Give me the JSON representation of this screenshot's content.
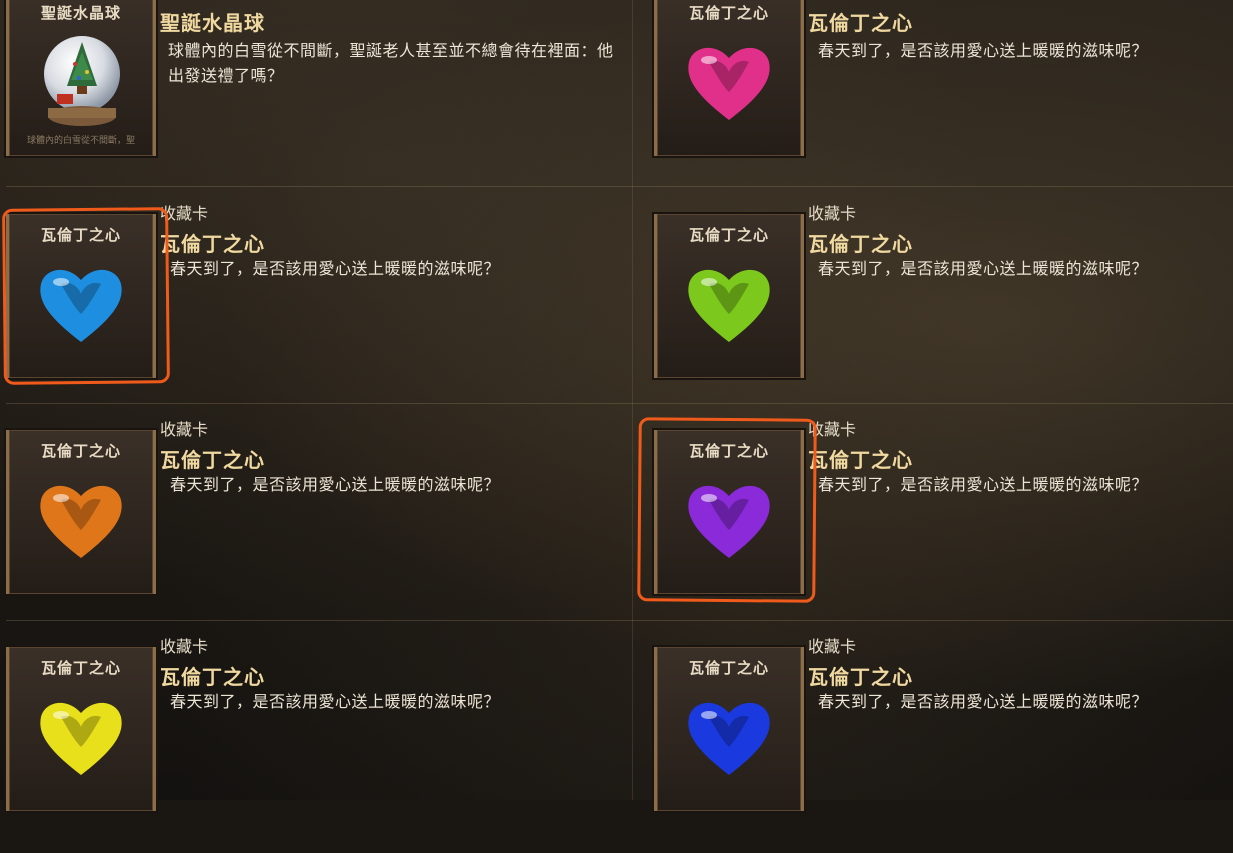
{
  "cards": [
    {
      "label": "",
      "title": "聖誕水晶球",
      "desc": "球體內的白雪從不間斷，聖誕老人甚至並不總會待在裡面：他出發送禮了嗎？",
      "thumb_title": "聖誕水晶球",
      "thumb_sub": "球體內的白雪從不間斷，聖",
      "icon": "snow-globe-icon"
    },
    {
      "label": "",
      "title": "瓦倫丁之心",
      "desc": "春天到了，是否該用愛心送上暖暖的滋味呢？",
      "thumb_title": "瓦倫丁之心",
      "color": "#e0308a",
      "icon": "pink-heart-icon"
    },
    {
      "label": "收藏卡",
      "title": "瓦倫丁之心",
      "desc": "春天到了，是否該用愛心送上暖暖的滋味呢？",
      "thumb_title": "瓦倫丁之心",
      "color": "#1e8fe0",
      "icon": "blue-heart-icon"
    },
    {
      "label": "收藏卡",
      "title": "瓦倫丁之心",
      "desc": "春天到了，是否該用愛心送上暖暖的滋味呢？",
      "thumb_title": "瓦倫丁之心",
      "color": "#7cc81c",
      "icon": "green-heart-icon"
    },
    {
      "label": "收藏卡",
      "title": "瓦倫丁之心",
      "desc": "春天到了，是否該用愛心送上暖暖的滋味呢？",
      "thumb_title": "瓦倫丁之心",
      "color": "#e0761a",
      "icon": "orange-heart-icon"
    },
    {
      "label": "收藏卡",
      "title": "瓦倫丁之心",
      "desc": "春天到了，是否該用愛心送上暖暖的滋味呢？",
      "thumb_title": "瓦倫丁之心",
      "color": "#8a2ad8",
      "icon": "purple-heart-icon"
    },
    {
      "label": "收藏卡",
      "title": "瓦倫丁之心",
      "desc": "春天到了，是否該用愛心送上暖暖的滋味呢？",
      "thumb_title": "瓦倫丁之心",
      "color": "#e8e01a",
      "icon": "yellow-heart-icon"
    },
    {
      "label": "收藏卡",
      "title": "瓦倫丁之心",
      "desc": "春天到了，是否該用愛心送上暖暖的滋味呢？",
      "thumb_title": "瓦倫丁之心",
      "color": "#1a3ae0",
      "icon": "navy-heart-icon"
    }
  ],
  "annotation_color": "#f05a1a"
}
